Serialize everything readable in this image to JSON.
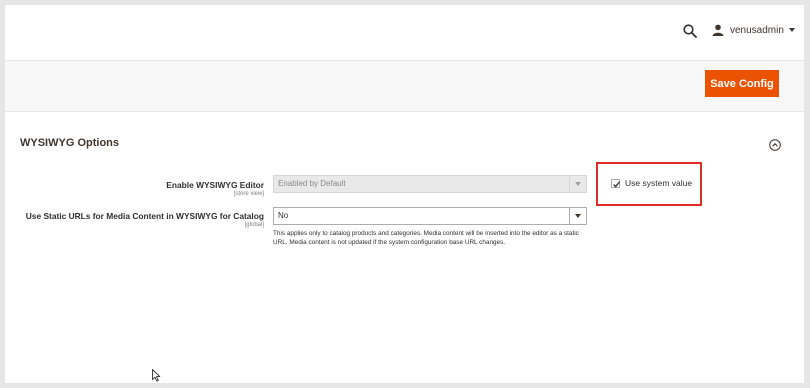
{
  "header": {
    "search_icon": "search-icon",
    "user_icon": "user-icon",
    "username": "venusadmin"
  },
  "action_bar": {
    "save_label": "Save Config",
    "save_color": "#eb5202"
  },
  "section": {
    "title": "WYSIWYG Options",
    "collapse_icon": "chevron-up-circle-icon",
    "fields": [
      {
        "label": "Enable WYSIWYG Editor",
        "scope": "[store view]",
        "value": "Enabled by Default",
        "disabled": true,
        "use_system_value": {
          "checked": true,
          "label": "Use system value"
        }
      },
      {
        "label": "Use Static URLs for Media Content in WYSIWYG for Catalog",
        "scope": "[global]",
        "value": "No",
        "disabled": false,
        "note": "This applies only to catalog products and categories. Media content will be inserted into the editor as a static URL. Media content is not updated if the system configuration base URL changes."
      }
    ]
  },
  "highlight_color": "#e02b27"
}
